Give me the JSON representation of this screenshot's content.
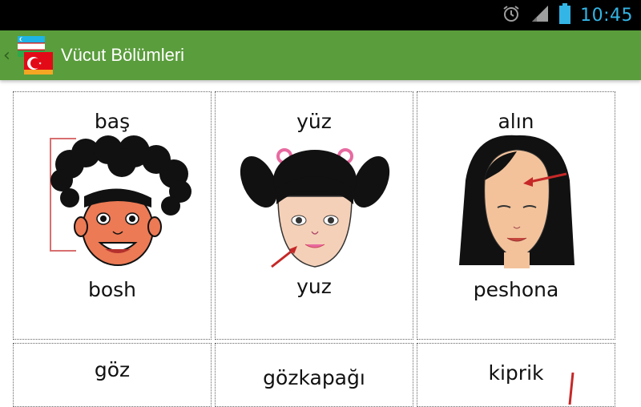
{
  "status_bar": {
    "time": "10:45",
    "icons": [
      "alarm-icon",
      "signal-icon",
      "battery-icon"
    ]
  },
  "action_bar": {
    "title": "Vücut Bölümleri",
    "up_icon": "chevron-left-icon",
    "logo": "flags-logo-icon"
  },
  "colors": {
    "action_bar": "#5a9d3c",
    "status_time": "#33b5e5",
    "arrow": "#c62828"
  },
  "cards": [
    {
      "top_word": "baş",
      "bottom_word": "bosh",
      "illustration": "girl-curly-hair-head-icon"
    },
    {
      "top_word": "yüz",
      "bottom_word": "yuz",
      "illustration": "girl-pigtails-face-icon"
    },
    {
      "top_word": "alın",
      "bottom_word": "peshona",
      "illustration": "girl-black-hair-forehead-icon"
    },
    {
      "top_word": "göz",
      "bottom_word": "",
      "illustration": ""
    },
    {
      "top_word": "gözkapağı",
      "bottom_word": "",
      "illustration": ""
    },
    {
      "top_word": "kiprik",
      "bottom_word": "",
      "illustration": ""
    }
  ]
}
